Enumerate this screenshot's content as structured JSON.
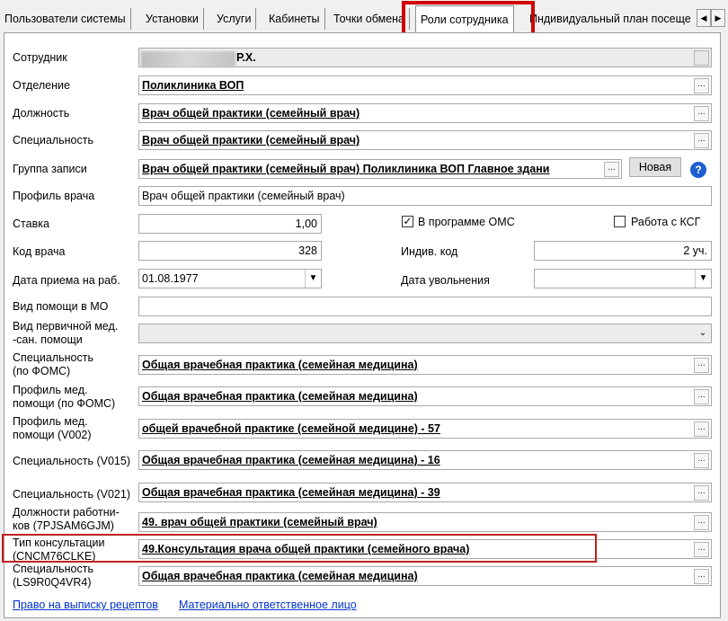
{
  "tabs": [
    {
      "label": "Пользователи системы"
    },
    {
      "label": "Установки"
    },
    {
      "label": "Услуги"
    },
    {
      "label": "Кабинеты"
    },
    {
      "label": "Точки обмена"
    },
    {
      "label": "Роли сотрудника"
    },
    {
      "label": "Индивидуальный план посеще"
    }
  ],
  "scroll_left": "◀",
  "scroll_right": "▶",
  "form": {
    "employee_label": "Сотрудник",
    "employee_value": "Р.Х.",
    "department_label": "Отделение",
    "department_value": "Поликлиника ВОП",
    "position_label": "Должность",
    "position_value": "Врач общей практики (семейный врач)",
    "specialty_label": "Специальность",
    "specialty_value": "Врач общей практики (семейный врач)",
    "group_label": "Группа записи",
    "group_value": "Врач общей практики (семейный врач) Поликлиника ВОП Главное здани",
    "new_button": "Новая",
    "help_glyph": "?",
    "doctor_profile_label": "Профиль врача",
    "doctor_profile_value": "Врач общей практики (семейный врач)",
    "rate_label": "Ставка",
    "rate_value": "1,00",
    "oms_label": "В программе ОМС",
    "oms_checked": "✓",
    "ksg_label": "Работа с КСГ",
    "doctor_code_label": "Код врача",
    "doctor_code_value": "328",
    "ind_code_label": "Индив. код",
    "ind_code_value": "2 уч.",
    "hire_date_label": "Дата приема на раб.",
    "hire_date_value": "01.08.1977",
    "dismiss_date_label": "Дата увольнения",
    "dismiss_date_value": "",
    "help_type_label": "Вид помощи в МО",
    "primary_help_label_1": "Вид первичной мед.",
    "primary_help_label_2": "-сан. помощи",
    "spec_foms_label_1": "Специальность",
    "spec_foms_label_2": "(по ФОМС)",
    "spec_foms_value": "Общая врачебная практика (семейная медицина)",
    "profile_foms_label_1": "Профиль  мед.",
    "profile_foms_label_2": "помощи (по ФОМС)",
    "profile_foms_value": "Общая врачебная практика (семейная медицина)",
    "profile_v002_label_1": "Профиль  мед.",
    "profile_v002_label_2": "помощи (V002)",
    "profile_v002_value": "общей врачебной практике (семейной медицине) - 57",
    "spec_v015_label": "Специальность (V015)",
    "spec_v015_value": "Общая врачебная практика (семейная медицина) - 16",
    "spec_v021_label": "Специальность (V021)",
    "spec_v021_value": "Общая врачебная практика (семейная медицина) - 39",
    "worker_pos_label_1": "Должности работни-",
    "worker_pos_label_2": "ков (7PJSAM6GJM)",
    "worker_pos_value": "49. врач общей практики (семейный врач)",
    "consult_type_label_1": "Тип консультации",
    "consult_type_label_2": "(CNCM76CLKE)",
    "consult_type_value": "49.Консультация врача общей практики (семейного врача)",
    "spec_ls_label_1": "Специальность",
    "spec_ls_label_2": "(LS9R0Q4VR4)",
    "spec_ls_value": "Общая врачебная практика (семейная медицина)",
    "dots_label": "..."
  },
  "links": {
    "prescription": "Право на выписку рецептов",
    "responsible": "Материально ответственное лицо"
  }
}
